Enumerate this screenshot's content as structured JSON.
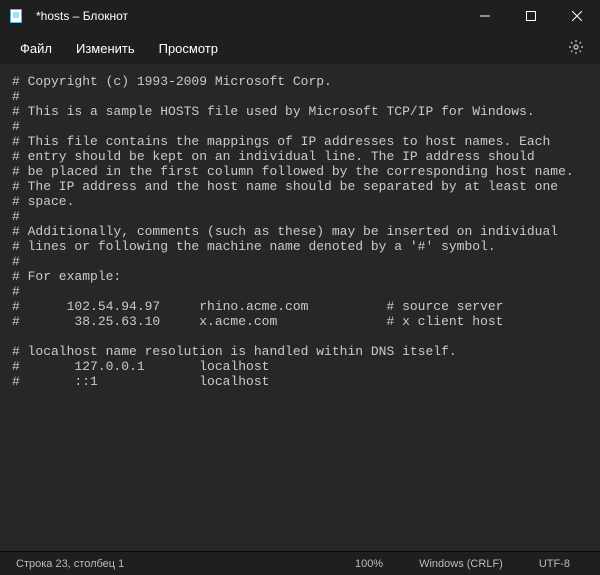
{
  "titlebar": {
    "title": "*hosts – Блокнот"
  },
  "menubar": {
    "file": "Файл",
    "edit": "Изменить",
    "view": "Просмотр"
  },
  "editor": {
    "content": "# Copyright (c) 1993-2009 Microsoft Corp.\n#\n# This is a sample HOSTS file used by Microsoft TCP/IP for Windows.\n#\n# This file contains the mappings of IP addresses to host names. Each\n# entry should be kept on an individual line. The IP address should\n# be placed in the first column followed by the corresponding host name.\n# The IP address and the host name should be separated by at least one\n# space.\n#\n# Additionally, comments (such as these) may be inserted on individual\n# lines or following the machine name denoted by a '#' symbol.\n#\n# For example:\n#\n#      102.54.94.97     rhino.acme.com          # source server\n#       38.25.63.10     x.acme.com              # x client host\n\n# localhost name resolution is handled within DNS itself.\n#\t127.0.0.1       localhost\n#\t::1             localhost"
  },
  "statusbar": {
    "position": "Строка 23, столбец 1",
    "zoom": "100%",
    "line_ending": "Windows (CRLF)",
    "encoding": "UTF-8"
  }
}
